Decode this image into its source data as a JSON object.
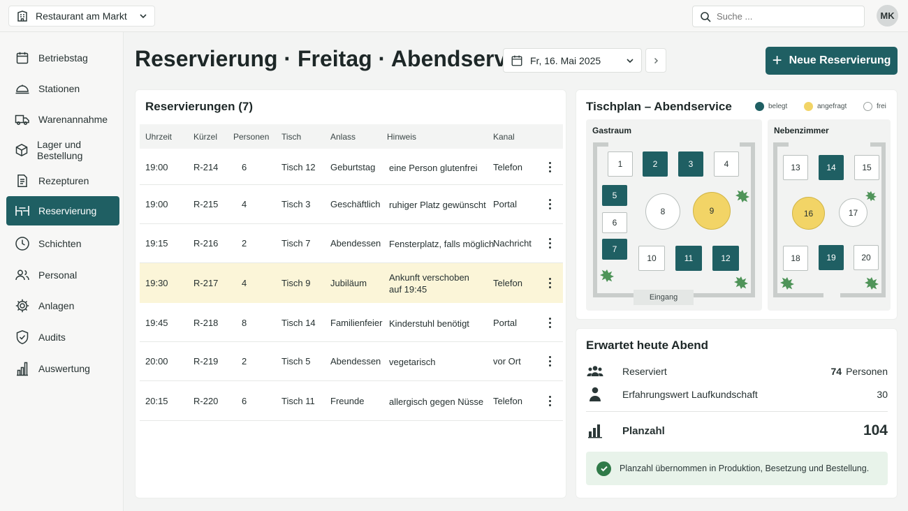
{
  "topbar": {
    "venue": "Restaurant am Markt",
    "search_placeholder": "Suche ...",
    "user_initials": "MK"
  },
  "sidebar": {
    "items": [
      {
        "label": "Betriebstag",
        "icon": "calendar-icon"
      },
      {
        "label": "Stationen",
        "icon": "cloche-icon"
      },
      {
        "label": "Warenannahme",
        "icon": "truck-icon"
      },
      {
        "label": "Lager und Bestellung",
        "icon": "box-icon"
      },
      {
        "label": "Rezepturen",
        "icon": "document-icon"
      },
      {
        "label": "Reservierung",
        "icon": "table-icon",
        "active": true
      },
      {
        "label": "Schichten",
        "icon": "clock-icon"
      },
      {
        "label": "Personal",
        "icon": "people-icon"
      },
      {
        "label": "Anlagen",
        "icon": "gear-icon"
      },
      {
        "label": "Audits",
        "icon": "shield-icon"
      },
      {
        "label": "Auswertung",
        "icon": "bar-chart-icon"
      }
    ]
  },
  "header": {
    "title": "Reservierung · Freitag · Abendservice",
    "date": "Fr, 16. Mai 2025",
    "new_button": "Neue Reservierung"
  },
  "reservations": {
    "title": "Reservierungen (7)",
    "columns": [
      "Uhrzeit",
      "Kürzel",
      "Personen",
      "Tisch",
      "Anlass",
      "Hinweis",
      "Kanal"
    ],
    "rows": [
      {
        "time": "19:00",
        "code": "R-214",
        "persons": "6",
        "table": "Tisch 12",
        "occasion": "Geburtstag",
        "note": "eine Person glutenfrei",
        "channel": "Telefon"
      },
      {
        "time": "19:00",
        "code": "R-215",
        "persons": "4",
        "table": "Tisch 3",
        "occasion": "Geschäftlich",
        "note": "ruhiger Platz gewünscht",
        "channel": "Portal"
      },
      {
        "time": "19:15",
        "code": "R-216",
        "persons": "2",
        "table": "Tisch 7",
        "occasion": "Abendessen",
        "note": "Fensterplatz, falls möglich",
        "channel": "Nachricht"
      },
      {
        "time": "19:30",
        "code": "R-217",
        "persons": "4",
        "table": "Tisch 9",
        "occasion": "Jubiläum",
        "note": "Ankunft verschoben auf 19:45",
        "channel": "Telefon",
        "highlight": true
      },
      {
        "time": "19:45",
        "code": "R-218",
        "persons": "8",
        "table": "Tisch 14",
        "occasion": "Familienfeier",
        "note": "Kinderstuhl benötigt",
        "channel": "Portal"
      },
      {
        "time": "20:00",
        "code": "R-219",
        "persons": "2",
        "table": "Tisch 5",
        "occasion": "Abendessen",
        "note": "vegetarisch",
        "channel": "vor Ort"
      },
      {
        "time": "20:15",
        "code": "R-220",
        "persons": "6",
        "table": "Tisch 11",
        "occasion": "Freunde",
        "note": "allergisch gegen Nüsse",
        "channel": "Telefon"
      }
    ]
  },
  "floorplan": {
    "title": "Tischplan – Abendservice",
    "legend": {
      "belegt": "belegt",
      "angefragt": "angefragt",
      "frei": "frei"
    },
    "legend_colors": {
      "belegt": "#1f5f63",
      "angefragt": "#f2d466",
      "frei": "#ffffff"
    },
    "room_main": "Gastraum",
    "room_side": "Nebenzimmer",
    "entrance": "Eingang",
    "tables": [
      {
        "n": "1",
        "status": "frei"
      },
      {
        "n": "2",
        "status": "belegt"
      },
      {
        "n": "3",
        "status": "belegt"
      },
      {
        "n": "4",
        "status": "frei"
      },
      {
        "n": "5",
        "status": "belegt"
      },
      {
        "n": "6",
        "status": "frei"
      },
      {
        "n": "7",
        "status": "belegt"
      },
      {
        "n": "8",
        "status": "frei"
      },
      {
        "n": "9",
        "status": "angefragt"
      },
      {
        "n": "10",
        "status": "frei"
      },
      {
        "n": "11",
        "status": "belegt"
      },
      {
        "n": "12",
        "status": "belegt"
      },
      {
        "n": "13",
        "status": "frei"
      },
      {
        "n": "14",
        "status": "belegt"
      },
      {
        "n": "15",
        "status": "frei"
      },
      {
        "n": "16",
        "status": "angefragt"
      },
      {
        "n": "17",
        "status": "frei"
      },
      {
        "n": "18",
        "status": "frei"
      },
      {
        "n": "19",
        "status": "belegt"
      },
      {
        "n": "20",
        "status": "frei"
      }
    ]
  },
  "expected": {
    "title": "Erwartet heute Abend",
    "reserved_label": "Reserviert",
    "reserved_value": "74",
    "reserved_unit": "Personen",
    "walkin_label": "Erfahrungswert Laufkundschaft",
    "walkin_value": "30",
    "plan_label": "Planzahl",
    "plan_value": "104",
    "notice": "Planzahl übernommen in Produktion, Besetzung und Bestellung."
  }
}
